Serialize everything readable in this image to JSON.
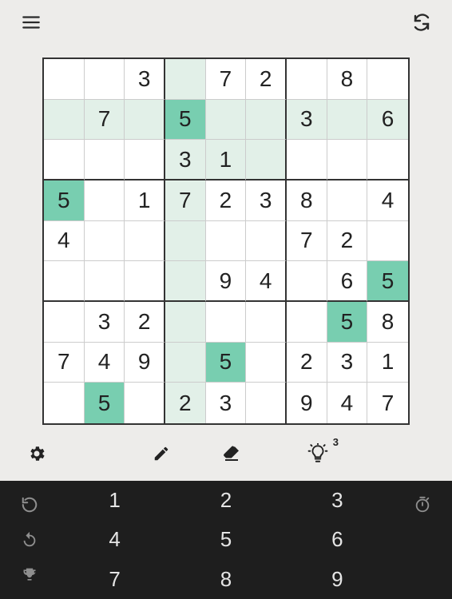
{
  "icons": {
    "menu": "menu-icon",
    "refresh": "refresh-icon",
    "gear": "gear-icon",
    "pencil": "pencil-icon",
    "eraser": "eraser-icon",
    "hint": "lightbulb-icon",
    "restart": "restart-icon",
    "undo": "undo-icon",
    "trophy": "trophy-icon",
    "timer": "timer-icon"
  },
  "hint_count": "3",
  "board": {
    "cells": [
      [
        {
          "v": ""
        },
        {
          "v": ""
        },
        {
          "v": "3"
        },
        {
          "v": "",
          "tint": true
        },
        {
          "v": "7"
        },
        {
          "v": "2"
        },
        {
          "v": ""
        },
        {
          "v": "8"
        },
        {
          "v": ""
        }
      ],
      [
        {
          "v": "",
          "tint": true
        },
        {
          "v": "7",
          "tint": true
        },
        {
          "v": "",
          "tint": true
        },
        {
          "v": "5",
          "sel": true
        },
        {
          "v": "",
          "tint": true
        },
        {
          "v": "",
          "tint": true
        },
        {
          "v": "3",
          "tint": true
        },
        {
          "v": "",
          "tint": true
        },
        {
          "v": "6",
          "tint": true
        }
      ],
      [
        {
          "v": ""
        },
        {
          "v": ""
        },
        {
          "v": ""
        },
        {
          "v": "3",
          "tint": true
        },
        {
          "v": "1",
          "tint": true
        },
        {
          "v": "",
          "tint": true
        },
        {
          "v": ""
        },
        {
          "v": ""
        },
        {
          "v": ""
        }
      ],
      [
        {
          "v": "5",
          "sel": true
        },
        {
          "v": ""
        },
        {
          "v": "1"
        },
        {
          "v": "7",
          "tint": true
        },
        {
          "v": "2"
        },
        {
          "v": "3"
        },
        {
          "v": "8"
        },
        {
          "v": ""
        },
        {
          "v": "4"
        }
      ],
      [
        {
          "v": "4"
        },
        {
          "v": ""
        },
        {
          "v": ""
        },
        {
          "v": "",
          "tint": true
        },
        {
          "v": ""
        },
        {
          "v": ""
        },
        {
          "v": "7"
        },
        {
          "v": "2"
        },
        {
          "v": ""
        }
      ],
      [
        {
          "v": ""
        },
        {
          "v": ""
        },
        {
          "v": ""
        },
        {
          "v": "",
          "tint": true
        },
        {
          "v": "9"
        },
        {
          "v": "4"
        },
        {
          "v": ""
        },
        {
          "v": "6"
        },
        {
          "v": "5",
          "sel": true
        }
      ],
      [
        {
          "v": ""
        },
        {
          "v": "3"
        },
        {
          "v": "2"
        },
        {
          "v": "",
          "tint": true
        },
        {
          "v": ""
        },
        {
          "v": ""
        },
        {
          "v": ""
        },
        {
          "v": "5",
          "sel": true
        },
        {
          "v": "8"
        }
      ],
      [
        {
          "v": "7"
        },
        {
          "v": "4"
        },
        {
          "v": "9"
        },
        {
          "v": "",
          "tint": true
        },
        {
          "v": "5",
          "sel": true
        },
        {
          "v": ""
        },
        {
          "v": "2"
        },
        {
          "v": "3"
        },
        {
          "v": "1"
        }
      ],
      [
        {
          "v": ""
        },
        {
          "v": "5",
          "sel": true
        },
        {
          "v": ""
        },
        {
          "v": "2",
          "tint": true
        },
        {
          "v": "3"
        },
        {
          "v": ""
        },
        {
          "v": "9"
        },
        {
          "v": "4"
        },
        {
          "v": "7"
        }
      ]
    ]
  },
  "numpad": [
    "1",
    "2",
    "3",
    "4",
    "5",
    "6",
    "7",
    "8",
    "9"
  ]
}
